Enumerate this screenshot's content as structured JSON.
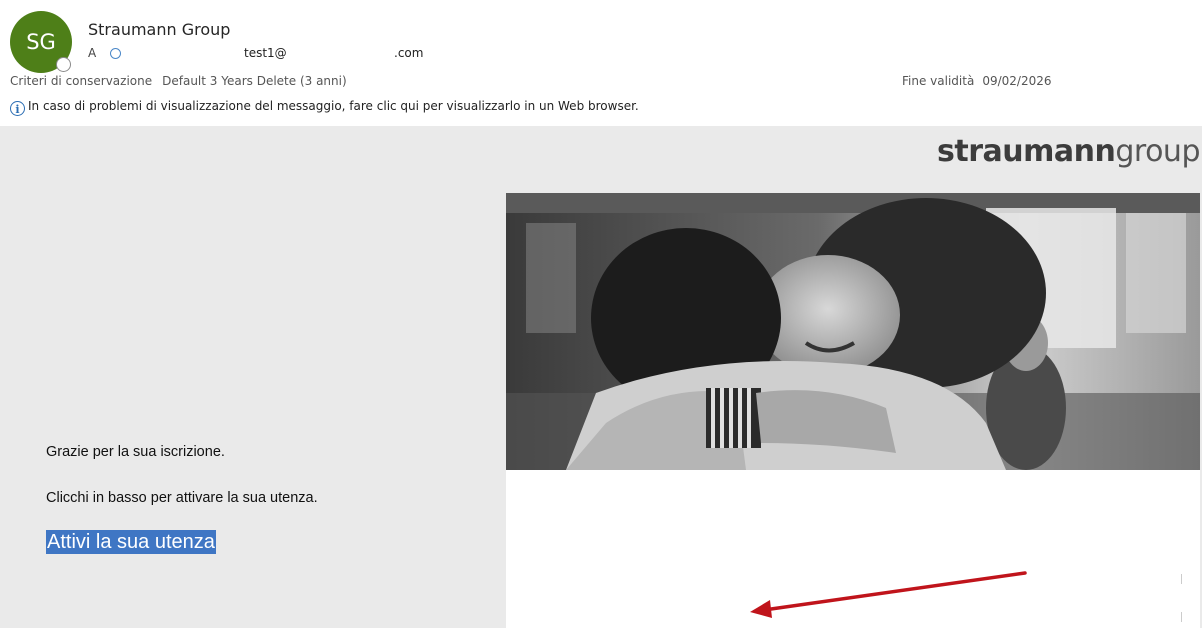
{
  "header": {
    "avatar_initials": "SG",
    "sender_name": "Straumann Group",
    "to_prefix": "A",
    "to_address_part1": "test1@",
    "to_address_part2": ".com",
    "retention_label": "Criteri di conservazione",
    "retention_value": "Default 3 Years Delete (3 anni)",
    "expiry_label": "Fine validità",
    "expiry_value": "09/02/2026",
    "info_text": "In caso di problemi di visualizzazione del messaggio, fare clic qui per visualizzarlo in un Web browser."
  },
  "email": {
    "brand_bold": "straumann",
    "brand_light": "group",
    "line1": "Grazie per la sua iscrizione.",
    "line2": "Clicchi in basso per attivare la sua utenza.",
    "activate_link": "Attivi la sua utenza"
  },
  "colors": {
    "avatar_bg": "#4e7f18",
    "info_icon": "#2b6db3",
    "link_highlight": "#3f76c4",
    "arrow": "#c0141b",
    "email_background": "#eaeaea"
  },
  "icons": {
    "info": "info-circle-icon",
    "presence": "presence-status-icon",
    "recipient_status": "recipient-status-icon"
  }
}
